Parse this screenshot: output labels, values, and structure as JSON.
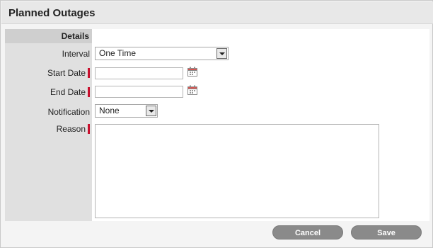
{
  "header": {
    "title": "Planned Outages"
  },
  "section": {
    "title": "Details"
  },
  "fields": {
    "interval": {
      "label": "Interval",
      "value": "One Time"
    },
    "start_date": {
      "label": "Start Date",
      "value": ""
    },
    "end_date": {
      "label": "End Date",
      "value": ""
    },
    "notification": {
      "label": "Notification",
      "value": "None"
    },
    "reason": {
      "label": "Reason",
      "value": ""
    }
  },
  "buttons": {
    "cancel": "Cancel",
    "save": "Save"
  },
  "colors": {
    "required_marker": "#c8102e",
    "button_bg": "#8a8a8a"
  }
}
